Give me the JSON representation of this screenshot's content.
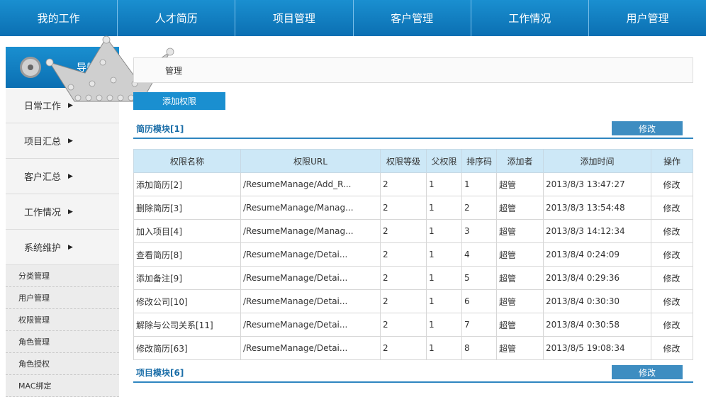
{
  "top_nav": [
    "我的工作",
    "人才简历",
    "项目管理",
    "客户管理",
    "工作情况",
    "用户管理"
  ],
  "sidebar": {
    "header_text": "导航",
    "items": [
      {
        "label": "日常工作"
      },
      {
        "label": "项目汇总"
      },
      {
        "label": "客户汇总"
      },
      {
        "label": "工作情况"
      },
      {
        "label": "系统维护"
      }
    ],
    "sub_items": [
      "分类管理",
      "用户管理",
      "权限管理",
      "角色管理",
      "角色授权",
      "MAC绑定"
    ]
  },
  "main": {
    "page_title": "管理",
    "add_button": "添加权限",
    "modules": [
      {
        "title": "简历模块[1]",
        "edit": "修改"
      },
      {
        "title": "项目模块[6]",
        "edit": "修改"
      }
    ],
    "table": {
      "headers": [
        "权限名称",
        "权限URL",
        "权限等级",
        "父权限",
        "排序码",
        "添加者",
        "添加时间",
        "操作"
      ],
      "rows": [
        [
          "添加简历[2]",
          "/ResumeManage/Add_R...",
          "2",
          "1",
          "1",
          "超管",
          "2013/8/3 13:47:27",
          "修改"
        ],
        [
          "删除简历[3]",
          "/ResumeManage/Manag...",
          "2",
          "1",
          "2",
          "超管",
          "2013/8/3 13:54:48",
          "修改"
        ],
        [
          "加入项目[4]",
          "/ResumeManage/Manag...",
          "2",
          "1",
          "3",
          "超管",
          "2013/8/3 14:12:34",
          "修改"
        ],
        [
          "查看简历[8]",
          "/ResumeManage/Detai...",
          "2",
          "1",
          "4",
          "超管",
          "2013/8/4 0:24:09",
          "修改"
        ],
        [
          "添加备注[9]",
          "/ResumeManage/Detai...",
          "2",
          "1",
          "5",
          "超管",
          "2013/8/4 0:29:36",
          "修改"
        ],
        [
          "修改公司[10]",
          "/ResumeManage/Detai...",
          "2",
          "1",
          "6",
          "超管",
          "2013/8/4 0:30:30",
          "修改"
        ],
        [
          "解除与公司关系[11]",
          "/ResumeManage/Detai...",
          "2",
          "1",
          "7",
          "超管",
          "2013/8/4 0:30:58",
          "修改"
        ],
        [
          "修改简历[63]",
          "/ResumeManage/Detai...",
          "2",
          "1",
          "8",
          "超管",
          "2013/8/5 19:08:34",
          "修改"
        ]
      ]
    }
  }
}
